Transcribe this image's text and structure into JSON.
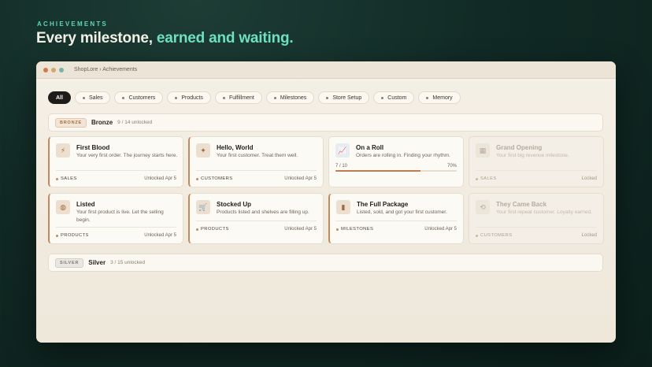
{
  "hero": {
    "eyebrow": "ACHIEVEMENTS",
    "title_main": "Every milestone, ",
    "title_accent": "earned and waiting."
  },
  "window": {
    "title": "ShopLore › Achievements"
  },
  "filters": [
    {
      "label": "All",
      "active": true
    },
    {
      "label": "Sales"
    },
    {
      "label": "Customers"
    },
    {
      "label": "Products"
    },
    {
      "label": "Fulfillment"
    },
    {
      "label": "Milestones"
    },
    {
      "label": "Store Setup"
    },
    {
      "label": "Custom"
    },
    {
      "label": "Memory"
    }
  ],
  "tiers": {
    "bronze": {
      "badge": "BRONZE",
      "name": "Bronze",
      "count": "9 / 14 unlocked"
    },
    "silver": {
      "badge": "SILVER",
      "name": "Silver",
      "count": "3 / 15 unlocked"
    }
  },
  "cards": [
    {
      "name": "First Blood",
      "desc": "Your very first order. The journey starts here.",
      "category": "SALES",
      "status": "Unlocked Apr 5",
      "icon": "bolt-icon",
      "glyph": "⚡",
      "state": "unlocked"
    },
    {
      "name": "Hello, World",
      "desc": "Your first customer. Treat them well.",
      "category": "CUSTOMERS",
      "status": "Unlocked Apr 5",
      "icon": "sparkle-icon",
      "glyph": "✦",
      "state": "unlocked"
    },
    {
      "name": "On a Roll",
      "desc": "Orders are rolling in. Finding your rhythm.",
      "progress_label": "7 / 10",
      "progress_pct": "70%",
      "progress": 0.7,
      "icon": "chart-icon",
      "glyph": "📈",
      "state": "progress"
    },
    {
      "name": "Grand Opening",
      "desc": "Your first big revenue milestone.",
      "category": "SALES",
      "status": "Locked",
      "icon": "store-icon",
      "glyph": "▦",
      "state": "locked"
    },
    {
      "name": "Listed",
      "desc": "Your first product is live. Let the selling begin.",
      "category": "PRODUCTS",
      "status": "Unlocked Apr 5",
      "icon": "box-icon",
      "glyph": "◍",
      "state": "unlocked"
    },
    {
      "name": "Stocked Up",
      "desc": "Products listed and shelves are filling up.",
      "category": "PRODUCTS",
      "status": "Unlocked Apr 5",
      "icon": "cart-icon",
      "glyph": "🛒",
      "state": "unlocked"
    },
    {
      "name": "The Full Package",
      "desc": "Listed, sold, and got your first customer.",
      "category": "MILESTONES",
      "status": "Unlocked Apr 5",
      "icon": "package-icon",
      "glyph": "▮",
      "state": "unlocked"
    },
    {
      "name": "They Came Back",
      "desc": "Your first repeat customer. Loyalty earned.",
      "category": "CUSTOMERS",
      "status": "Locked",
      "icon": "refresh-icon",
      "glyph": "⟲",
      "state": "locked"
    }
  ]
}
